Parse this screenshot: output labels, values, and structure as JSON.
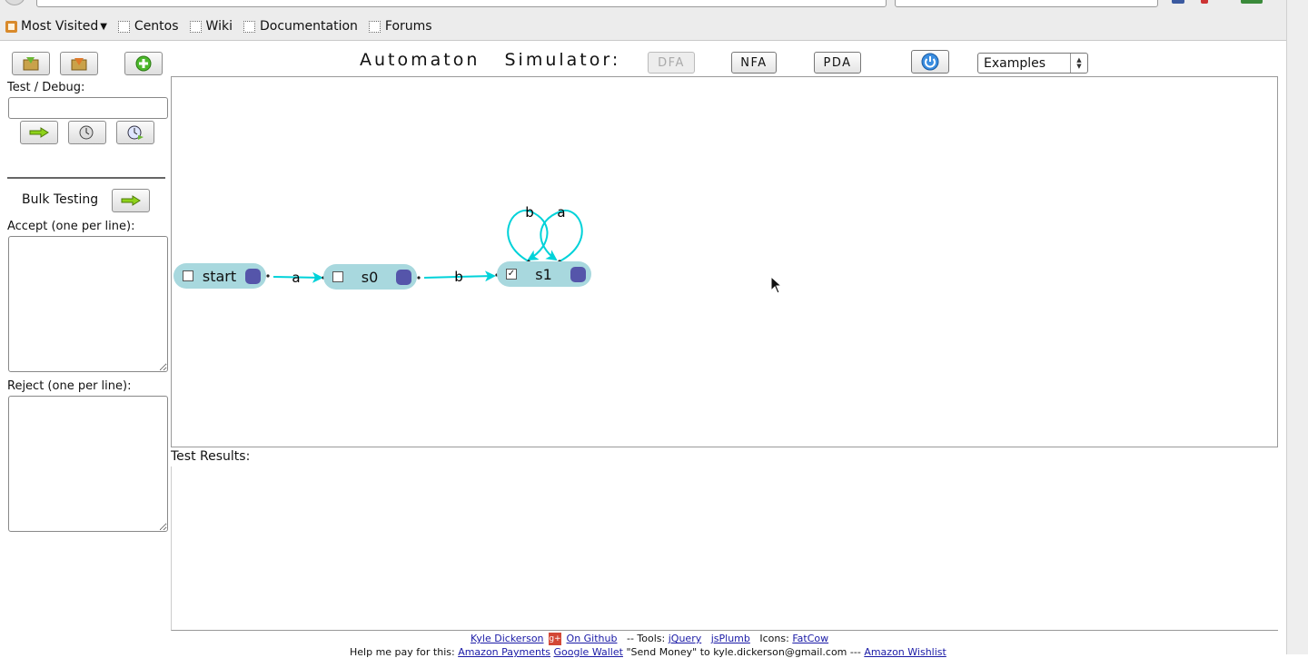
{
  "browser": {
    "bookmarks": [
      {
        "label": "Most Visited"
      },
      {
        "label": "Centos"
      },
      {
        "label": "Wiki"
      },
      {
        "label": "Documentation"
      },
      {
        "label": "Forums"
      }
    ]
  },
  "sidebar": {
    "test_debug_label": "Test / Debug:",
    "test_input_value": "",
    "bulk_label": "Bulk Testing",
    "accept_label": "Accept (one per line):",
    "reject_label": "Reject (one per line):",
    "accept_value": "",
    "reject_value": ""
  },
  "header": {
    "title": "Automaton   Simulator:",
    "modes": [
      "DFA",
      "NFA",
      "PDA"
    ],
    "active_mode": "DFA",
    "examples_label": "Examples"
  },
  "automaton": {
    "states": [
      {
        "name": "start",
        "accepting": false
      },
      {
        "name": "s0",
        "accepting": false
      },
      {
        "name": "s1",
        "accepting": true
      }
    ],
    "transitions": [
      {
        "from": "start",
        "to": "s0",
        "symbol": "a"
      },
      {
        "from": "s0",
        "to": "s1",
        "symbol": "b"
      },
      {
        "from": "s1",
        "to": "s1",
        "symbol": "b"
      },
      {
        "from": "s1",
        "to": "s1",
        "symbol": "a"
      }
    ],
    "edge_color": "#00d2d9",
    "state_color": "#a8d8de",
    "handle_color": "#5555aa"
  },
  "results": {
    "label": "Test Results:"
  },
  "footer": {
    "author": "Kyle Dickerson",
    "github": "On Github",
    "tools_label": "-- Tools:",
    "tool1": "jQuery",
    "tool2": "jsPlumb",
    "icons_label": "Icons:",
    "icons_link": "FatCow",
    "line2_prefix": "Help me pay for this:",
    "amazon_payments": "Amazon Payments",
    "google_wallet": "Google Wallet",
    "send_money": "\"Send Money\" to kyle.dickerson@gmail.com ---",
    "wishlist": "Amazon Wishlist"
  }
}
